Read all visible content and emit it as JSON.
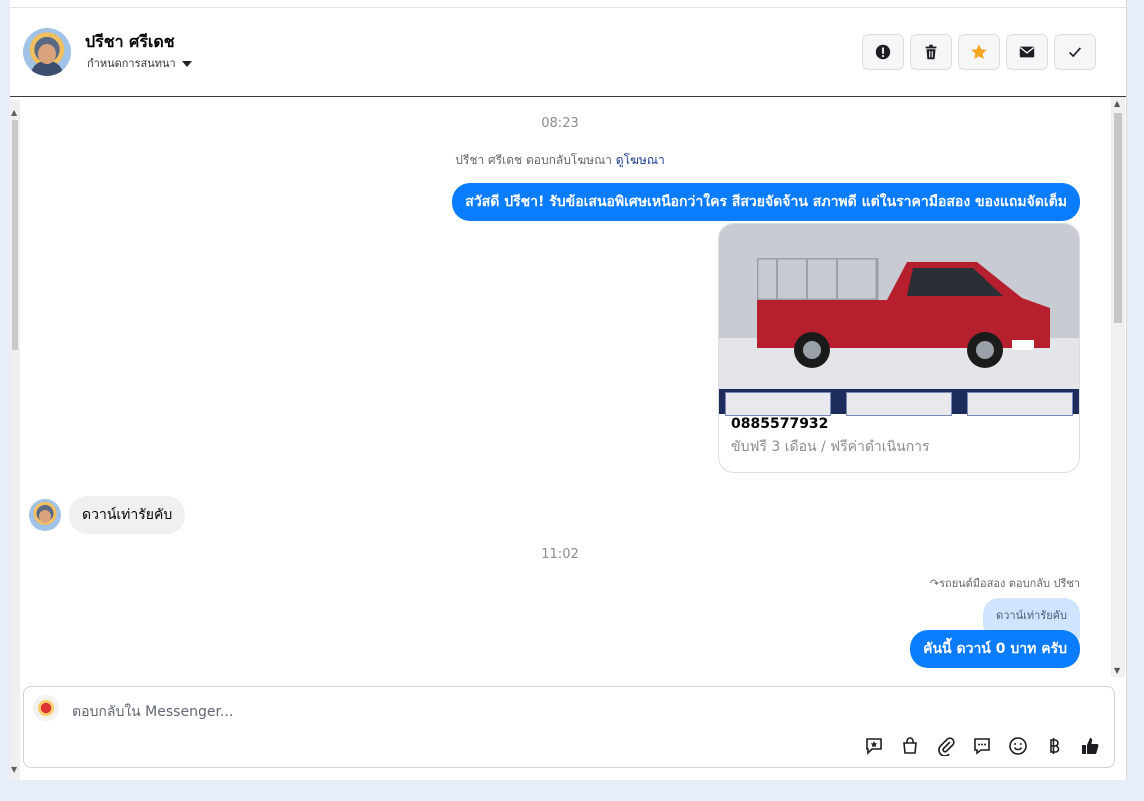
{
  "contact": {
    "name": "ปรีชา ศรีเดช",
    "subtitle": "กำหนดการสนทนา"
  },
  "header_actions": [
    {
      "name": "spam-button",
      "icon": "exclamation-circle-icon"
    },
    {
      "name": "delete-button",
      "icon": "trash-icon"
    },
    {
      "name": "star-button",
      "icon": "star-icon",
      "color": "#f5a623"
    },
    {
      "name": "mark-unread-button",
      "icon": "envelope-icon"
    },
    {
      "name": "done-button",
      "icon": "check-icon"
    }
  ],
  "messages": {
    "time1": "08:23",
    "system_note": "ปรีชา ศรีเดช ตอบกลับโฆษณา",
    "system_link": "ดูโฆษณา",
    "outgoing1": "สวัสดี ปรีชา! รับข้อเสนอพิเศษเหนือกว่าใคร สีสวยจัดจ้าน สภาพดี แต่ในราคามือสอง ของแถมจัดเต็ม",
    "card_phone": "0885577932",
    "card_desc": "ขับฟรี 3 เดือน / ฟรีค่าดำเนินการ",
    "incoming1": "ดวาน์เท่ารัยคับ",
    "time2": "11:02",
    "reply_note": "รถยนต์มือสอง ตอบกลับ ปรีชา",
    "quoted": "ดวาน์เท่ารัยคับ",
    "outgoing2": "คันนี้ ดวาน์ 0 บาท ครับ"
  },
  "composer": {
    "placeholder": "ตอบกลับใน Messenger..."
  },
  "colors": {
    "accent": "#0a7cff",
    "star": "#f5a623"
  }
}
